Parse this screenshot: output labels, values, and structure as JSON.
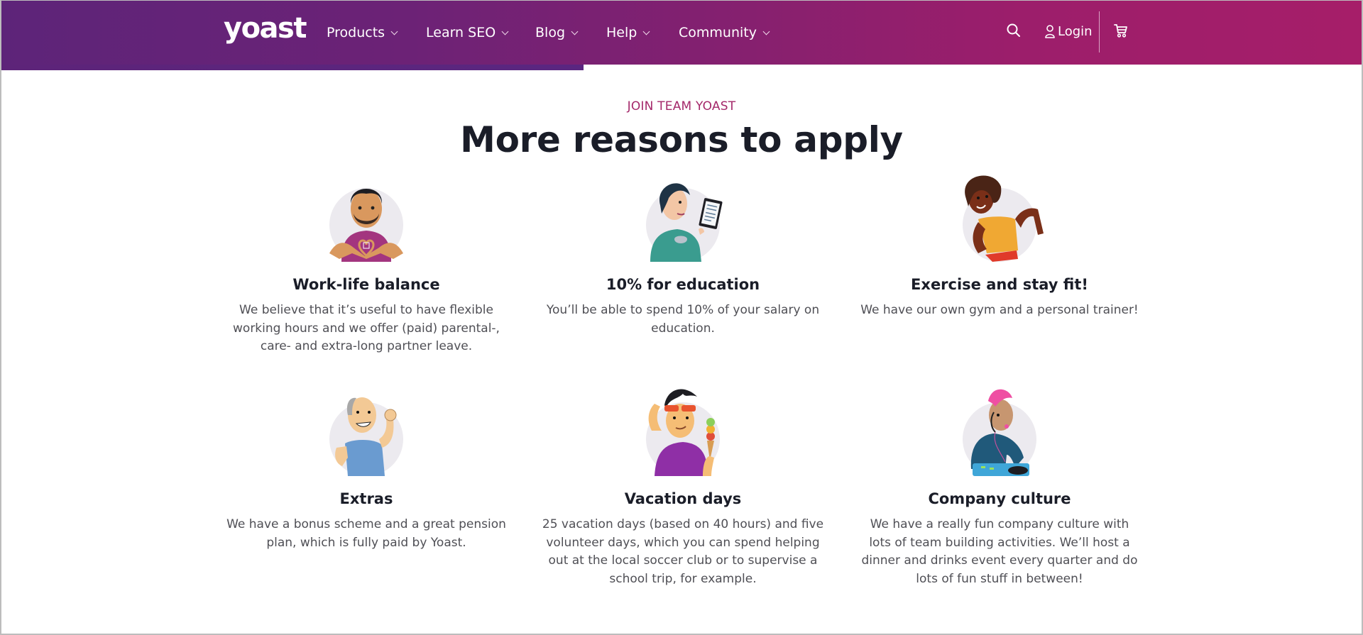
{
  "header": {
    "logo": "yoast",
    "nav": [
      {
        "label": "Products"
      },
      {
        "label": "Learn SEO"
      },
      {
        "label": "Blog"
      },
      {
        "label": "Help"
      },
      {
        "label": "Community"
      }
    ],
    "search_icon": "search-icon",
    "login_label": "Login",
    "cart_icon": "cart-icon",
    "colors": {
      "gradient_start": "#5d2479",
      "gradient_end": "#a61e69"
    }
  },
  "section": {
    "eyebrow": "JOIN TEAM YOAST",
    "title": "More reasons to apply",
    "accent_color": "#a4286a",
    "cards": [
      {
        "title": "Work-life balance",
        "body": "We believe that it’s useful to have flexible working hours and we offer (paid) parental-, care- and extra-long partner leave.",
        "illustration": "man-making-heart-hands"
      },
      {
        "title": "10% for education",
        "body": "You’ll be able to spend 10% of your salary on education.",
        "illustration": "woman-reading-tablet-with-tea"
      },
      {
        "title": "Exercise and stay fit!",
        "body": "We have our own gym and a personal trainer!",
        "illustration": "woman-running"
      },
      {
        "title": "Extras",
        "body": "We have a bonus scheme and a great pension plan, which is fully paid by Yoast.",
        "illustration": "older-man-flexing"
      },
      {
        "title": "Vacation days",
        "body": "25 vacation days (based on 40 hours) and five volunteer days, which you can spend helping out at the local soccer club or to supervise a school trip, for example.",
        "illustration": "man-with-sunglasses-and-ice-cream"
      },
      {
        "title": "Company culture",
        "body": "We have a really fun company culture with lots of team building activities. We’ll host a dinner and drinks event every quarter and do lots of fun stuff in between!",
        "illustration": "dj-with-pink-hair"
      }
    ]
  }
}
